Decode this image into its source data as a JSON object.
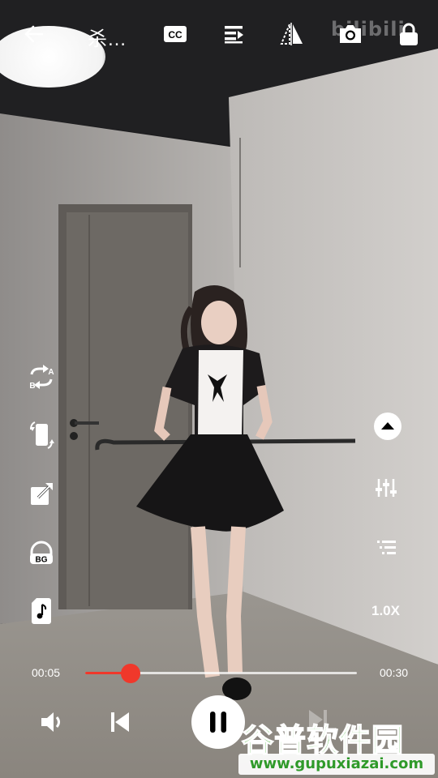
{
  "header": {
    "back_icon": "arrow-left-icon",
    "title": "杀…",
    "watermark": "bilibili",
    "actions": [
      "cc-icon",
      "playlist-icon",
      "ab-perspective-icon",
      "camera-icon",
      "lock-icon"
    ]
  },
  "left_controls": [
    "ab-repeat-icon",
    "rotate-screen-icon",
    "popout-window-icon",
    "background-play-icon",
    "audio-only-icon"
  ],
  "right_controls": [
    "collapse-up-icon",
    "equalizer-icon",
    "chapter-list-icon"
  ],
  "playback": {
    "current_time": "00:05",
    "total_time": "00:30",
    "progress": 0.1667,
    "speed": "1.0X",
    "state": "playing"
  },
  "bottom_controls": [
    "volume-icon",
    "previous-icon",
    "pause-icon"
  ],
  "site_watermark": {
    "name": "谷普软件园",
    "url": "www.gupuxiazai.com"
  },
  "colors": {
    "accent": "#f0382b",
    "watermark_green": "#46b135"
  }
}
